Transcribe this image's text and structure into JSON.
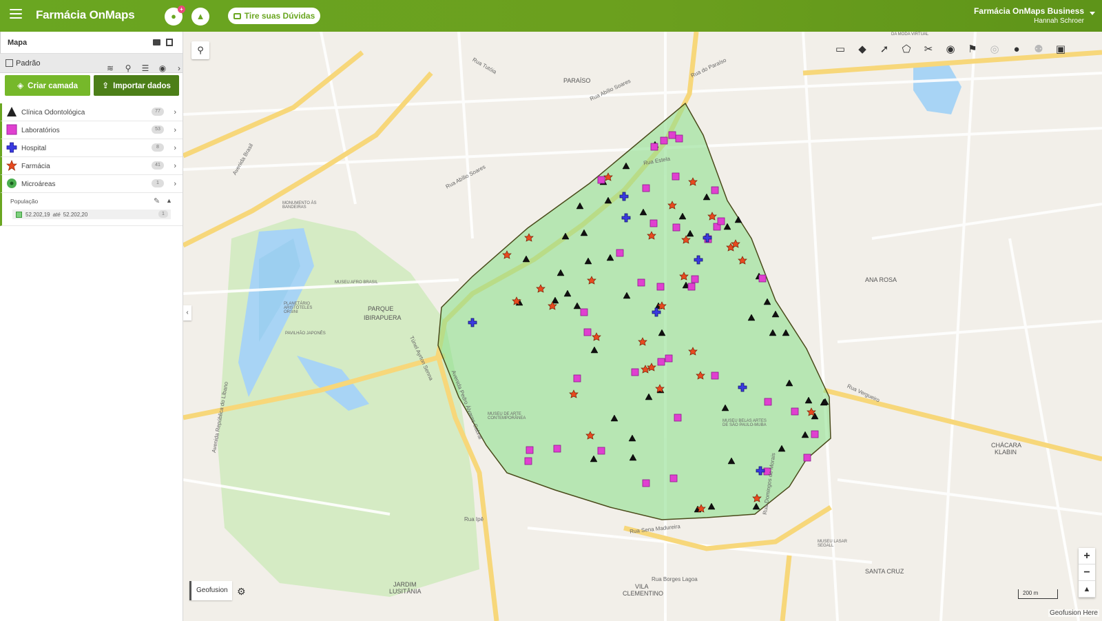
{
  "header": {
    "brand": "Farmácia OnMaps",
    "doubts_label": "Tire suas Dúvidas",
    "company": "Farmácia OnMaps Business",
    "user": "Hannah Schroer"
  },
  "sidebar": {
    "title": "Mapa",
    "view": "Padrão",
    "create_label": "Criar camada",
    "import_label": "Importar dados",
    "layers": [
      {
        "label": "Clínica Odontológica",
        "count": "77",
        "symbol": "triangle",
        "color": "#222222"
      },
      {
        "label": "Laboratórios",
        "count": "53",
        "symbol": "square",
        "color": "#e040d0"
      },
      {
        "label": "Hospital",
        "count": "8",
        "symbol": "cross",
        "color": "#3a3ae0"
      },
      {
        "label": "Farmácia",
        "count": "41",
        "symbol": "star",
        "color": "#e84a1f"
      },
      {
        "label": "Microáreas",
        "count": "1",
        "symbol": "dot",
        "color": "#4caf50"
      }
    ],
    "legend": {
      "title": "População",
      "from": "52.202,19",
      "sep": "até",
      "to": "52.202,20",
      "count": "1"
    }
  },
  "map": {
    "base_label": "Geofusion",
    "scale_label": "200 m",
    "attribution": "Geofusion Here",
    "zoom_in": "+",
    "zoom_out": "−",
    "labels": {
      "paraiso": "PARAÍSO",
      "parque": "PARQUE",
      "ibirapuera": "IBIRAPUERA",
      "ana_rosa": "ANA ROSA",
      "chacara": "CHÁCARA",
      "klabin": "KLABIN",
      "vila": "VILA",
      "clementino": "CLEMENTINO",
      "jardim": "JARDIM",
      "lusitania": "LUSITÂNIA",
      "santa_cruz": "SANTA CRUZ",
      "rua_estela": "Rua Estela",
      "rua_tutoia": "Rua Tutóia",
      "rua_abilio": "Rua Abílio Soares",
      "rua_sena": "Rua Sena Madureira",
      "rua_ipe": "Rua Ipê",
      "rua_borges": "Rua Borges Lagoa",
      "rua_paraiso": "Rua do Paraíso",
      "rua_vergueiro": "Rua Vergueiro",
      "rua_domingos": "Rua Domingos de Morais",
      "av_brasil": "Avenida Brasil",
      "tunel": "Túnel Ayrton Senna",
      "av_pedro": "Avenida Pedro Álvares Cabral",
      "av_republica": "Avenida República do Líbano",
      "mon_bandeiras": "MONUMENTO ÀS BANDEIRAS",
      "museu_afro": "MUSEU AFRO BRASIL",
      "planetario": "PLANETÁRIO ARISTÓTELES ORSINI",
      "pav_japones": "PAVILHÃO JAPONÊS",
      "museu_arte": "MUSEU DE ARTE CONTEMPORÂNEA",
      "museu_belas": "MUSEU BELAS ARTES DE SÃO PAULO-MUBA",
      "museu_lasar": "MUSEU LASAR SEGALL",
      "da_moda": "DA MODA VIRTUAL"
    }
  }
}
